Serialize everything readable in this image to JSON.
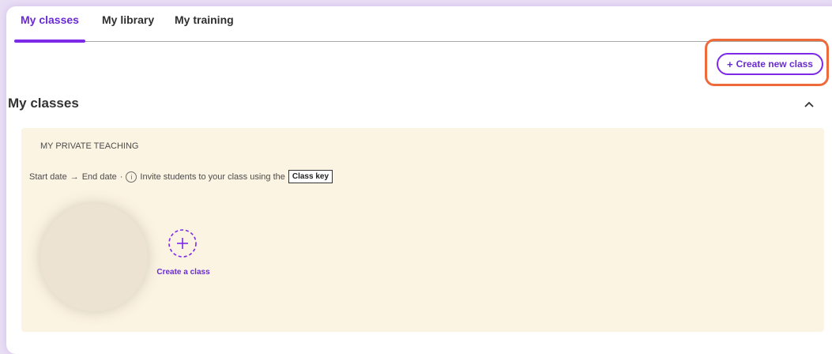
{
  "tabs": [
    {
      "label": "My classes",
      "active": true
    },
    {
      "label": "My library",
      "active": false
    },
    {
      "label": "My training",
      "active": false
    }
  ],
  "create_new_class_button": {
    "label": "Create new class",
    "icon": "plus-icon"
  },
  "section": {
    "title": "My classes",
    "collapse_icon": "chevron-up-icon"
  },
  "class_card": {
    "name": "MY PRIVATE TEACHING",
    "start_date": "Start date",
    "arrow": "→",
    "end_date": "End date",
    "separator": "·",
    "invite_text": "Invite students to your class using the",
    "class_key_label": "Class key",
    "create_class_label": "Create a class"
  },
  "colors": {
    "accent": "#7c2ae8",
    "highlight": "#ef6a3a",
    "class_bg": "#fcf4e3"
  }
}
